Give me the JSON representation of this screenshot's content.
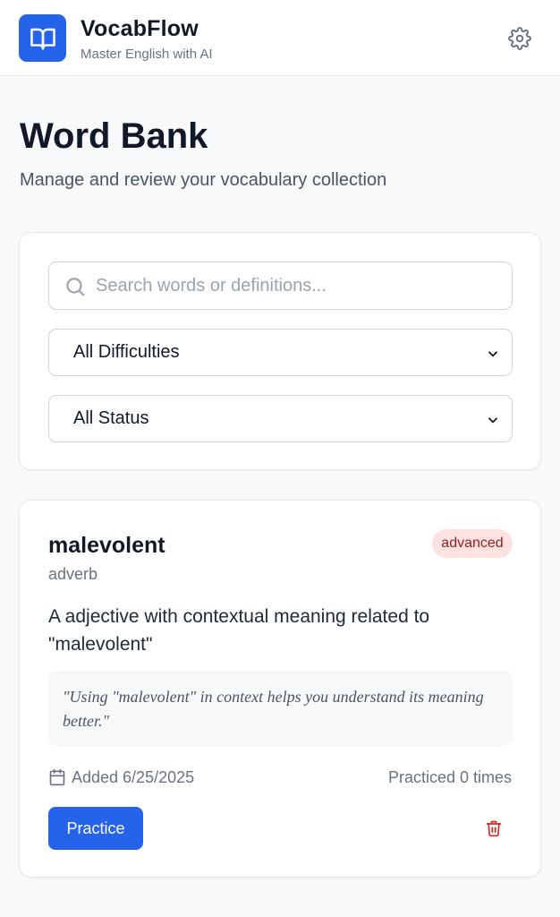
{
  "header": {
    "app_title": "VocabFlow",
    "app_subtitle": "Master English with AI",
    "logo_icon": "book-open-icon",
    "settings_icon": "gear-icon"
  },
  "page": {
    "title": "Word Bank",
    "subtitle": "Manage and review your vocabulary collection"
  },
  "filters": {
    "search_placeholder": "Search words or definitions...",
    "search_value": "",
    "difficulty_selected": "All Difficulties",
    "status_selected": "All Status"
  },
  "words": [
    {
      "word": "malevolent",
      "part_of_speech": "adverb",
      "difficulty": "advanced",
      "definition": "A adjective with contextual meaning related to \"malevolent\"",
      "example": "\"Using \"malevolent\" in context helps you understand its meaning better.\"",
      "added_label": "Added 6/25/2025",
      "practiced_label": "Practiced 0 times",
      "practice_label": "Practice"
    }
  ],
  "colors": {
    "accent": "#2563eb",
    "badge_bg": "#fee2e2",
    "badge_text": "#991b1b",
    "delete": "#dc2626"
  }
}
